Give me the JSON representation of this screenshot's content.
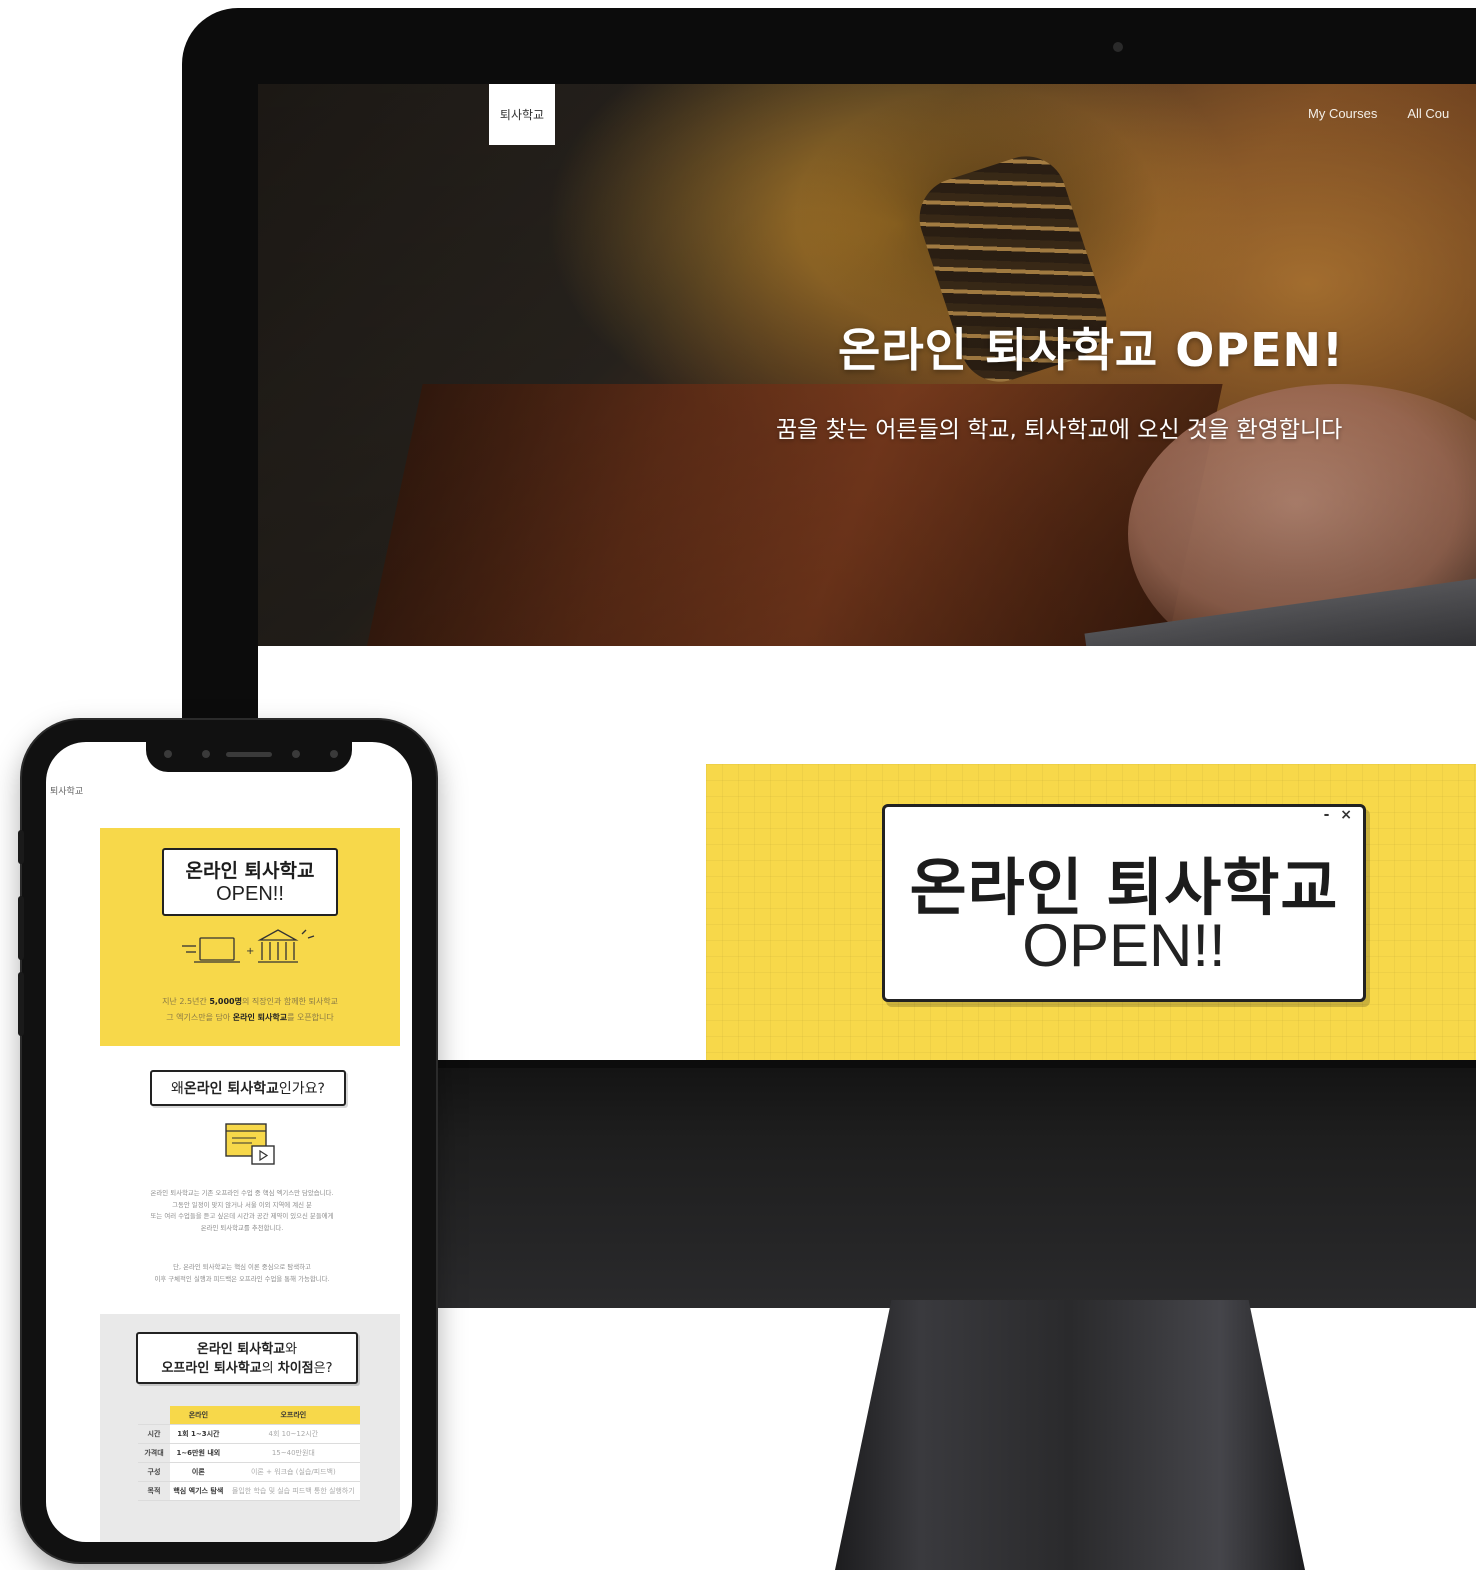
{
  "desktop": {
    "logo": "퇴사학교",
    "nav": {
      "my_courses": "My Courses",
      "all_courses": "All Cou"
    },
    "hero": {
      "title": "온라인 퇴사학교 OPEN!",
      "subtitle": "꿈을 찾는 어른들의 학교, 퇴사학교에 오신 것을 환영합니다"
    },
    "banner": {
      "window_controls": "- ×",
      "line1": "온라인 퇴사학교",
      "line2": "OPEN!!"
    }
  },
  "mobile": {
    "logo": "퇴사학교",
    "banner": {
      "line1": "온라인 퇴사학교",
      "line2": "OPEN!!",
      "text1_pre": "지난 2.5년간 ",
      "text1_strong": "5,000명",
      "text1_post": "의 직장인과 함께한 퇴사학교",
      "text2_pre": "그 엑기스만을 담아 ",
      "text2_strong": "온라인 퇴사학교",
      "text2_post": "를 오픈합니다"
    },
    "why": {
      "pre": "왜 ",
      "strong": "온라인 퇴사학교",
      "post": "인가요?"
    },
    "paragraph1": [
      "온라인 퇴사학교는 기존 오프라인 수업 중 핵심 엑기스만 담았습니다.",
      "그동안 일정이 맞지 않거나 서울 이외 지역에 계신 분",
      "또는 여러 수업들을 듣고 싶은데 시간과 공간 제약이 있으신 분들에게",
      "온라인 퇴사학교를 추천합니다."
    ],
    "paragraph2": [
      "단, 온라인 퇴사학교는 핵심 이론 중심으로 탐색하고",
      "이후 구체적인 실행과 피드백은 오프라인 수업을 통해 가능합니다."
    ],
    "difference": {
      "line1_strong": "온라인 퇴사학교",
      "line1_post": "와",
      "line2_strong": "오프라인 퇴사학교",
      "line2_mid": "의 ",
      "line2_strong2": "차이점",
      "line2_post": "은?"
    },
    "table": {
      "headers": [
        "온라인",
        "오프라인"
      ],
      "rows": [
        {
          "label": "시간",
          "online": "1회 1~3시간",
          "offline": "4회 10~12시간"
        },
        {
          "label": "가격대",
          "online": "1~6만원 내외",
          "offline": "15~40만원대"
        },
        {
          "label": "구성",
          "online": "이론",
          "offline": "이론 + 워크숍 (실습/피드백)"
        },
        {
          "label": "목적",
          "online": "핵심 엑기스 탐색",
          "offline": "몰입한 학습 및 실습 피드백 통한 실행하기"
        }
      ]
    }
  },
  "colors": {
    "accent_yellow": "#f7d84a",
    "device_black": "#111111"
  },
  "icons": [
    "camera-icon",
    "laptop-icon",
    "school-building-icon",
    "document-video-icon"
  ]
}
